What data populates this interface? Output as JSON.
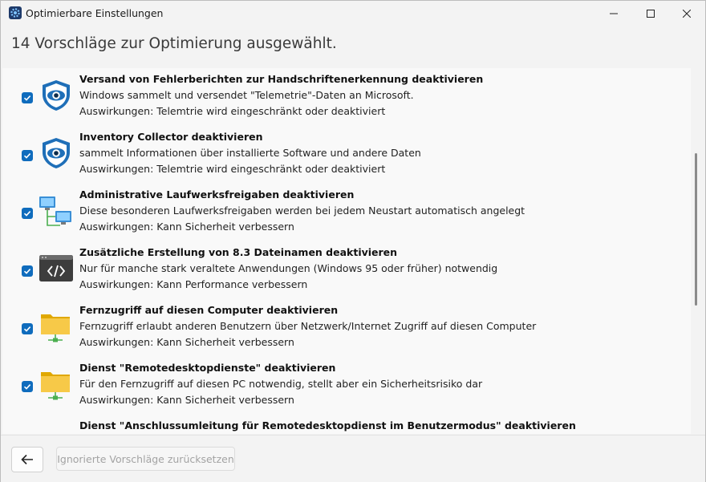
{
  "window": {
    "title": "Optimierbare Einstellungen",
    "app_icon": "gear-icon",
    "controls": [
      "minimize-icon",
      "maximize-icon",
      "close-icon"
    ]
  },
  "header": {
    "text": "14 Vorschläge zur Optimierung ausgewählt."
  },
  "items": [
    {
      "checked": true,
      "icon": "shield-eye-icon",
      "title": "Versand von Fehlerberichten zur Handschriftenerkennung deaktivieren",
      "description": "Windows sammelt und versendet \"Telemetrie\"-Daten an Microsoft.",
      "impact": "Auswirkungen: Telemtrie wird eingeschränkt oder deaktiviert"
    },
    {
      "checked": true,
      "icon": "shield-eye-icon",
      "title": "Inventory Collector deaktivieren",
      "description": "sammelt Informationen über installierte Software und andere Daten",
      "impact": "Auswirkungen: Telemtrie wird eingeschränkt oder deaktiviert"
    },
    {
      "checked": true,
      "icon": "network-computers-icon",
      "title": "Administrative Laufwerksfreigaben deaktivieren",
      "description": "Diese besonderen Laufwerksfreigaben werden bei jedem Neustart automatisch angelegt",
      "impact": "Auswirkungen: Kann Sicherheit verbessern"
    },
    {
      "checked": true,
      "icon": "code-window-icon",
      "title": "Zusätzliche Erstellung von 8.3 Dateinamen deaktivieren",
      "description": "Nur für manche stark veraltete Anwendungen (Windows 95 oder früher) notwendig",
      "impact": "Auswirkungen: Kann Performance verbessern"
    },
    {
      "checked": true,
      "icon": "network-folder-icon",
      "title": "Fernzugriff auf diesen Computer deaktivieren",
      "description": "Fernzugriff erlaubt anderen Benutzern über Netzwerk/Internet Zugriff auf diesen Computer",
      "impact": "Auswirkungen: Kann Sicherheit verbessern"
    },
    {
      "checked": true,
      "icon": "network-folder-icon",
      "title": "Dienst \"Remotedesktopdienste\" deaktivieren",
      "description": "Für den Fernzugriff auf diesen PC notwendig, stellt aber ein Sicherheitsrisiko dar",
      "impact": "Auswirkungen: Kann Sicherheit verbessern"
    },
    {
      "checked": true,
      "icon": "network-folder-icon",
      "title": "Dienst \"Anschlussumleitung für Remotedesktopdienst im Benutzermodus\" deaktivieren",
      "description": "",
      "impact": ""
    }
  ],
  "footer": {
    "back_icon": "arrow-left-icon",
    "reset_label": "Ignorierte Vorschläge zurücksetzen",
    "reset_enabled": false
  },
  "colors": {
    "accent": "#0f6cbd",
    "folder": "#f7c948",
    "shield": "#1f6fb8"
  }
}
